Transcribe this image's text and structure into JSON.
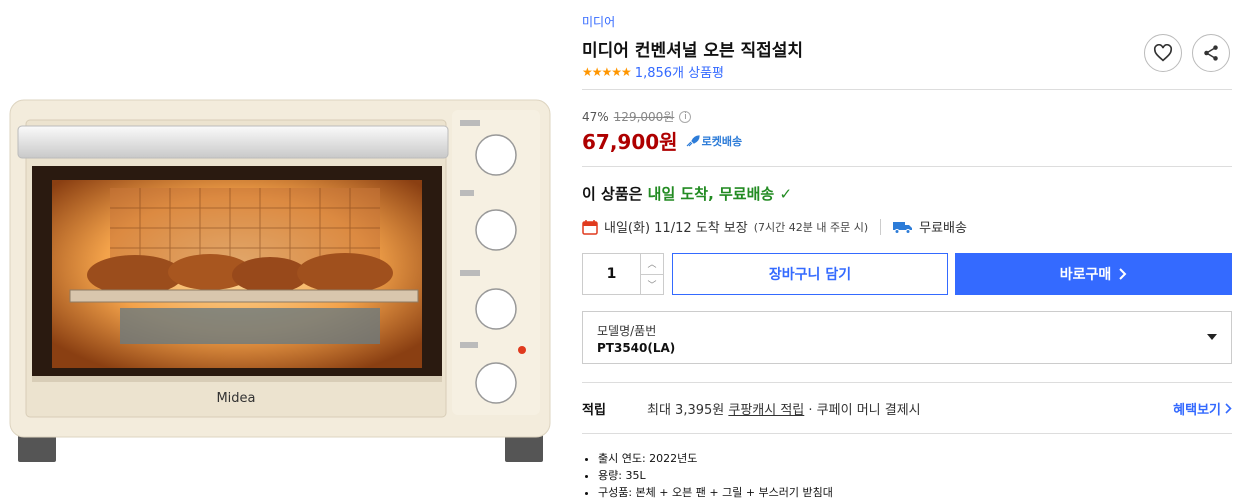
{
  "product": {
    "brand_link": "미디어",
    "title": "미디어 컨벤셔널 오븐 직접설치",
    "rating_stars": "★★★★★",
    "review_count": "1,856개 상품평",
    "image_brand_logo": "Midea"
  },
  "pricing": {
    "discount_rate": "47%",
    "original_price": "129,000원",
    "info_icon": "i",
    "sale_price": "67,900원",
    "rocket_label": "로켓배송"
  },
  "arrival": {
    "prefix": "이 상품은 ",
    "highlight": "내일 도착, 무료배송",
    "check": "✓"
  },
  "delivery": {
    "date_text": "내일(화) 11/12 도착 보장",
    "note": "(7시간 42분 내 주문 시)",
    "free_shipping": "무료배송"
  },
  "purchase": {
    "quantity": "1",
    "qty_up": "︿",
    "qty_down": "﹀",
    "cart_label": "장바구니 담기",
    "buy_label": "바로구매"
  },
  "option": {
    "label": "모델명/품번",
    "value": "PT3540(LA)"
  },
  "points": {
    "title": "적립",
    "text_before": "최대 3,395원 ",
    "link": "쿠팡캐시 적립",
    "text_after": " · 쿠페이 머니 결제시",
    "benefit_link": "혜택보기"
  },
  "specs": [
    "출시 연도: 2022년도",
    "용량: 35L",
    "구성품: 본체 + 오븐 팬 + 그릴 + 부스러기 받침대"
  ],
  "icons": {
    "heart": "heart-icon",
    "share": "share-icon",
    "calendar": "calendar-icon",
    "truck": "truck-icon",
    "rocket": "rocket-icon"
  },
  "colors": {
    "accent_blue": "#346aff",
    "price_red": "#ae0000",
    "arrival_green": "#228b22",
    "star_orange": "#ff9600"
  }
}
